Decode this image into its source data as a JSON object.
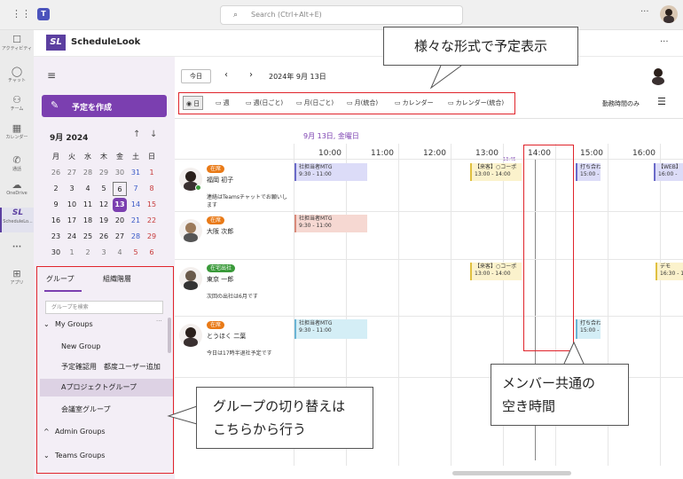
{
  "teams": {
    "search_placeholder": "Search (Ctrl+Alt+E)",
    "more": "···",
    "rail": [
      {
        "label": "アクティビティ",
        "icon": "bell-icon"
      },
      {
        "label": "チャット",
        "icon": "chat-icon"
      },
      {
        "label": "チーム",
        "icon": "teams-icon"
      },
      {
        "label": "カレンダー",
        "icon": "calendar-icon"
      },
      {
        "label": "通話",
        "icon": "phone-icon"
      },
      {
        "label": "OneDrive",
        "icon": "cloud-icon"
      },
      {
        "label": "ScheduleLo...",
        "icon": "schedulelook-icon"
      },
      {
        "label": "···",
        "icon": "more-icon"
      },
      {
        "label": "アプリ",
        "icon": "apps-icon"
      }
    ]
  },
  "app": {
    "name": "ScheduleLook",
    "logo": "SL",
    "more": "···"
  },
  "sidebar": {
    "create_label": "予定を作成",
    "month_label": "9月 2024",
    "weekdays": [
      "月",
      "火",
      "水",
      "木",
      "金",
      "土",
      "日"
    ],
    "weeks": [
      [
        "26",
        "27",
        "28",
        "29",
        "30",
        "31",
        "1"
      ],
      [
        "2",
        "3",
        "4",
        "5",
        "6",
        "7",
        "8"
      ],
      [
        "9",
        "10",
        "11",
        "12",
        "13",
        "14",
        "15"
      ],
      [
        "16",
        "17",
        "18",
        "19",
        "20",
        "21",
        "22"
      ],
      [
        "23",
        "24",
        "25",
        "26",
        "27",
        "28",
        "29"
      ],
      [
        "30",
        "1",
        "2",
        "3",
        "4",
        "5",
        "6"
      ]
    ],
    "tabs": [
      "グループ",
      "組織階層"
    ],
    "group_search_placeholder": "グループを検索",
    "groups": [
      {
        "label": "My Groups",
        "type": "header"
      },
      {
        "label": "New Group",
        "type": "item"
      },
      {
        "label": "予定確認用　都度ユーザー追加",
        "type": "item"
      },
      {
        "label": "Aプロジェクトグループ",
        "type": "item-selected"
      },
      {
        "label": "会議室グループ",
        "type": "item"
      },
      {
        "label": "Admin Groups",
        "type": "header-collapsed"
      },
      {
        "label": "Teams Groups",
        "type": "header"
      }
    ]
  },
  "toolbar": {
    "today_label": "今日",
    "date_label": "2024年 9月 13日",
    "views": [
      "日",
      "週",
      "週(日ごと)",
      "月(日ごと)",
      "月(統合)",
      "カレンダー",
      "カレンダー(統合)"
    ],
    "work_hours_label": "勤務時間のみ"
  },
  "schedule": {
    "day_header": "9月 13日, 金曜日",
    "hours": [
      "10:00",
      "11:00",
      "12:00",
      "13:00",
      "14:00",
      "15:00",
      "16:00"
    ],
    "now_marker": "13:45",
    "members": [
      {
        "status": "在席",
        "status_color": "#e97a17",
        "name": "福岡 初子",
        "note": "連絡はTeamsチャットでお願いします",
        "events": [
          {
            "title": "社担当者MTG",
            "time": "9:30 - 11:00",
            "color": "#dcdcf8",
            "accent": "#6a6ac8"
          },
          {
            "title": "【来客】○コーポ",
            "time": "13:00 - 14:00",
            "color": "#fbf2cc",
            "accent": "#e0c040"
          },
          {
            "title": "打ち合わせ",
            "time": "15:00 -",
            "color": "#dcdcf8",
            "accent": "#6a6ac8"
          },
          {
            "title": "【WEB】",
            "time": "16:00 -",
            "color": "#dcdcf8",
            "accent": "#6a6ac8"
          }
        ]
      },
      {
        "status": "在席",
        "status_color": "#e97a17",
        "name": "大阪 次郎",
        "note": "",
        "events": [
          {
            "title": "社担当者MTG",
            "time": "9:30 - 11:00",
            "color": "#f6d8d2",
            "accent": "#d88a7a"
          }
        ]
      },
      {
        "status": "在宅出社",
        "status_color": "#3a9a3a",
        "name": "東京 一郎",
        "note": "次回の出社は6月です",
        "events": [
          {
            "title": "【来客】○コーポ",
            "time": "13:00 - 14:00",
            "color": "#fbf2cc",
            "accent": "#e0c040"
          },
          {
            "title": "デモ",
            "time": "16:30 - 1",
            "color": "#fbf2cc",
            "accent": "#e0c040"
          }
        ]
      },
      {
        "status": "在席",
        "status_color": "#e97a17",
        "name": "とうほく 二葉",
        "note": "今日は17時半退社予定です",
        "events": [
          {
            "title": "社担当者MTG",
            "time": "9:30 - 11:00",
            "color": "#d4eef6",
            "accent": "#6ab4d4"
          },
          {
            "title": "打ち合わ",
            "time": "15:00 -",
            "color": "#d4eef6",
            "accent": "#6ab4d4"
          }
        ]
      }
    ]
  },
  "callouts": {
    "views": "様々な形式で予定表示",
    "free_time_line1": "メンバー共通の",
    "free_time_line2": "空き時間",
    "groups_line1": "グループの切り替えは",
    "groups_line2": "こちらから行う"
  },
  "colors": {
    "accent": "#7b3fb0",
    "highlight_border": "#e0242b",
    "sidebar_bg": "#f3eef6"
  }
}
